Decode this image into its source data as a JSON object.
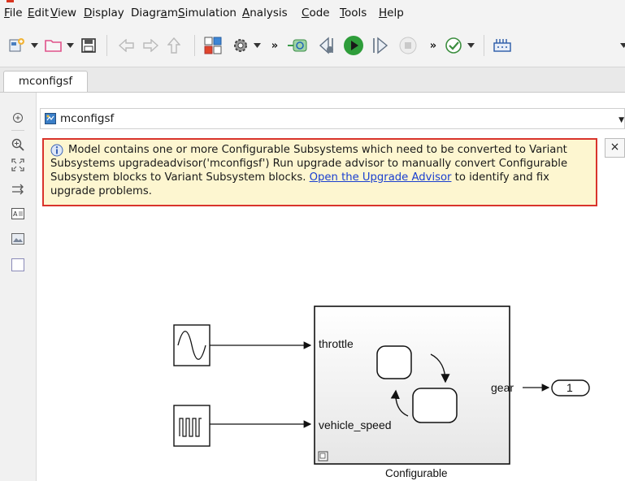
{
  "menubar": {
    "items": [
      {
        "label": "File",
        "u": "F",
        "rest": "ile"
      },
      {
        "label": "Edit",
        "u": "E",
        "rest": "dit"
      },
      {
        "label": "View",
        "u": "V",
        "rest": "iew"
      },
      {
        "label": "Display",
        "u": "D",
        "rest": "isplay"
      },
      {
        "label": "Diagram",
        "pre": "Diagr",
        "u": "a",
        "rest": "m"
      },
      {
        "label": "Simulation",
        "u": "S",
        "rest": "imulation"
      },
      {
        "label": "Analysis",
        "u": "A",
        "rest": "nalysis"
      },
      {
        "label": "Code",
        "u": "C",
        "rest": "ode"
      },
      {
        "label": "Tools",
        "u": "T",
        "rest": "ools"
      },
      {
        "label": "Help",
        "u": "H",
        "rest": "elp"
      }
    ]
  },
  "toolbar": {
    "overflow_1": "»",
    "overflow_2": "»",
    "icons": [
      "new-model-icon",
      "open-folder-icon",
      "save-icon",
      "back-arrow-icon",
      "forward-arrow-icon",
      "up-arrow-icon",
      "library-browser-icon",
      "model-settings-icon",
      "record-icon",
      "step-back-icon",
      "run-icon",
      "step-forward-icon",
      "stop-icon",
      "check-icon",
      "hardware-icon"
    ]
  },
  "tabs": [
    {
      "label": "mconfigsf"
    }
  ],
  "address": {
    "label": "mconfigsf"
  },
  "info_banner": {
    "text_before_link": "Model contains one or more Configurable Subsystems which need to be converted to Variant Subsystems upgradeadvisor('mconfigsf') Run upgrade advisor to manually convert Configurable Subsystem blocks to Variant Subsystem blocks.",
    "link_text": "Open the Upgrade Advisor",
    "text_after_link": "to identify and fix upgrade problems.",
    "close_label": "×"
  },
  "diagram": {
    "subsystem_name": "Configurable",
    "input_ports": [
      "throttle",
      "vehicle_speed"
    ],
    "output_port": "gear",
    "outport_number": "1"
  },
  "colors": {
    "banner_bg": "#fdf6d0",
    "banner_border": "#d9342c",
    "link": "#1a3fd0",
    "run_green": "#2e9d3a"
  }
}
